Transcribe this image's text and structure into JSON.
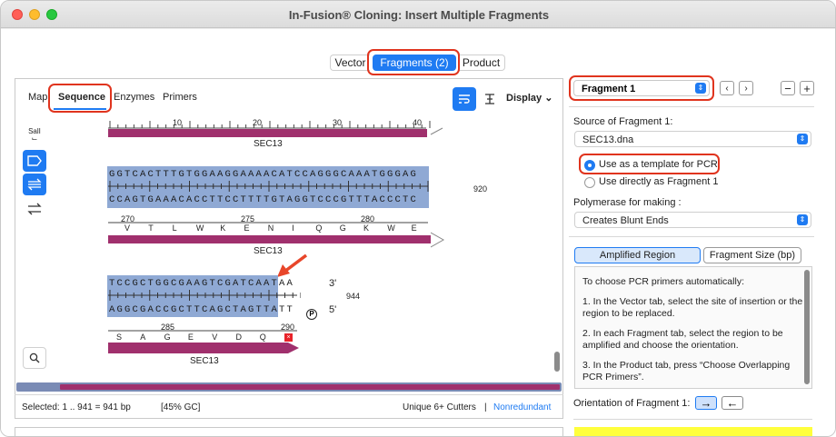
{
  "window": {
    "title": "In-Fusion® Cloning: Insert Multiple Fragments"
  },
  "top_tabs": {
    "vector": "Vector",
    "fragments": "Fragments (2)",
    "product": "Product"
  },
  "sub_tabs": {
    "map": "Map",
    "sequence": "Sequence",
    "enzymes": "Enzymes",
    "primers": "Primers"
  },
  "toolbar": {
    "display": "Display"
  },
  "tools": {
    "enzyme_label": "SalI"
  },
  "sequence": {
    "ruler_ticks": [
      "10",
      "20",
      "30",
      "40"
    ],
    "feature_name": "SEC13",
    "block1_top": "GGTCACTTTGTGGAAGGAAAACATCCAGGGCAAATGGGAG",
    "block1_bottom": "CCAGTGAAACACCTTCCTTTTGTAGGTCCCGTTTACCCTC",
    "block1_nums": [
      "270",
      "275",
      "280"
    ],
    "block1_aa": [
      "V",
      "T",
      "L",
      "W",
      "K",
      "E",
      "N",
      "I",
      "Q",
      "G",
      "K",
      "W",
      "E"
    ],
    "side_num_1": "920",
    "block2_top": "TCCGCTGGCGAAGTCGATCAATAA",
    "block2_bottom": "AGGCGACCGCTTCAGCTAGTTATT",
    "end3": "3'",
    "end5": "5'",
    "side_num_2": "944",
    "block2_nums": [
      "285",
      "290"
    ],
    "block2_aa": [
      "S",
      "A",
      "G",
      "E",
      "V",
      "D",
      "Q"
    ],
    "phospho": "P"
  },
  "status": {
    "selected": "Selected:  1 .. 941  =  941 bp",
    "gc": "[45% GC]",
    "cutters": "Unique 6+ Cutters",
    "separator": "|",
    "nonredundant": "Nonredundant"
  },
  "right": {
    "fragment_select": "Fragment 1",
    "source_label": "Source of Fragment 1:",
    "source_value": "SEC13.dna",
    "radio_template": "Use as a template for PCR",
    "radio_direct": "Use directly as Fragment 1",
    "polymerase_label": "Polymerase for making :",
    "polymerase_value": "Creates Blunt Ends",
    "tab_amplified": "Amplified Region",
    "tab_size": "Fragment Size (bp)",
    "info": [
      "To choose PCR primers automatically:",
      "1. In the Vector tab, select the site of insertion or the region to be replaced.",
      "2. In each Fragment tab, select the region to be amplified and choose the orientation.",
      "3. In the Product tab, press “Choose Overlapping PCR Primers”."
    ],
    "orientation_label": "Orientation of Fragment 1:"
  },
  "colors": {
    "accent": "#1f7bf2",
    "highlight": "#e0341e",
    "feature": "#a0306d",
    "selection": "#8fa9d4"
  }
}
